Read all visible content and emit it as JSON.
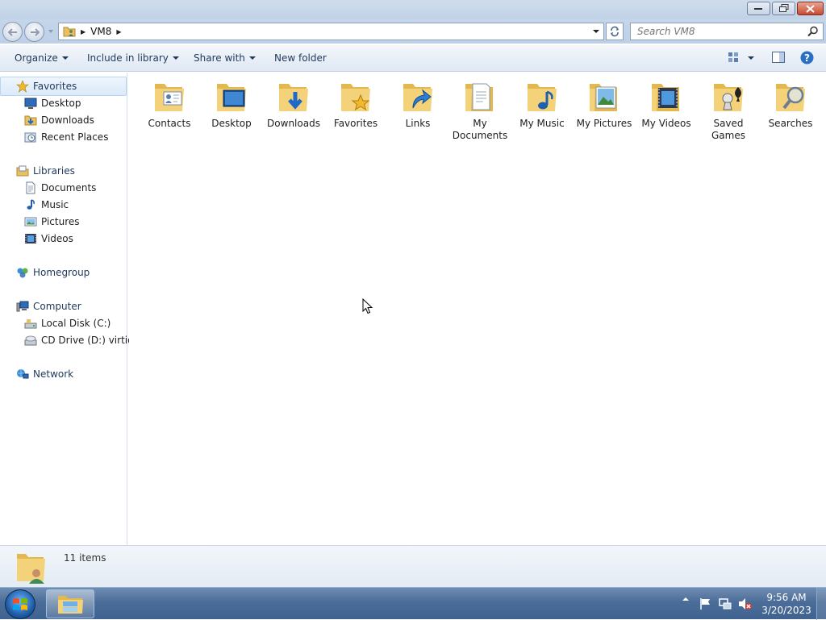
{
  "window": {
    "address": {
      "path": [
        "VM8"
      ]
    },
    "search": {
      "placeholder": "Search VM8"
    }
  },
  "toolbar": {
    "organize": "Organize",
    "include_in_library": "Include in library",
    "share_with": "Share with",
    "new_folder": "New folder"
  },
  "navpane": {
    "favorites": {
      "label": "Favorites",
      "items": [
        "Desktop",
        "Downloads",
        "Recent Places"
      ]
    },
    "libraries": {
      "label": "Libraries",
      "items": [
        "Documents",
        "Music",
        "Pictures",
        "Videos"
      ]
    },
    "homegroup": {
      "label": "Homegroup"
    },
    "computer": {
      "label": "Computer",
      "items": [
        "Local Disk (C:)",
        "CD Drive (D:) virtio-win"
      ]
    },
    "network": {
      "label": "Network"
    }
  },
  "content": {
    "items": [
      {
        "name": "Contacts",
        "icon": "contacts-folder-icon"
      },
      {
        "name": "Desktop",
        "icon": "desktop-folder-icon"
      },
      {
        "name": "Downloads",
        "icon": "downloads-folder-icon"
      },
      {
        "name": "Favorites",
        "icon": "favorites-folder-icon"
      },
      {
        "name": "Links",
        "icon": "links-folder-icon"
      },
      {
        "name": "My Documents",
        "icon": "documents-folder-icon"
      },
      {
        "name": "My Music",
        "icon": "music-folder-icon"
      },
      {
        "name": "My Pictures",
        "icon": "pictures-folder-icon"
      },
      {
        "name": "My Videos",
        "icon": "videos-folder-icon"
      },
      {
        "name": "Saved Games",
        "icon": "saved-games-folder-icon"
      },
      {
        "name": "Searches",
        "icon": "searches-folder-icon"
      }
    ]
  },
  "details": {
    "count": "11 items"
  },
  "taskbar": {
    "clock_time": "9:56 AM",
    "clock_date": "3/20/2023"
  },
  "colors": {
    "accent": "#1e395b",
    "folder": "#f4d27a",
    "taskbar": "#4b6d99"
  }
}
